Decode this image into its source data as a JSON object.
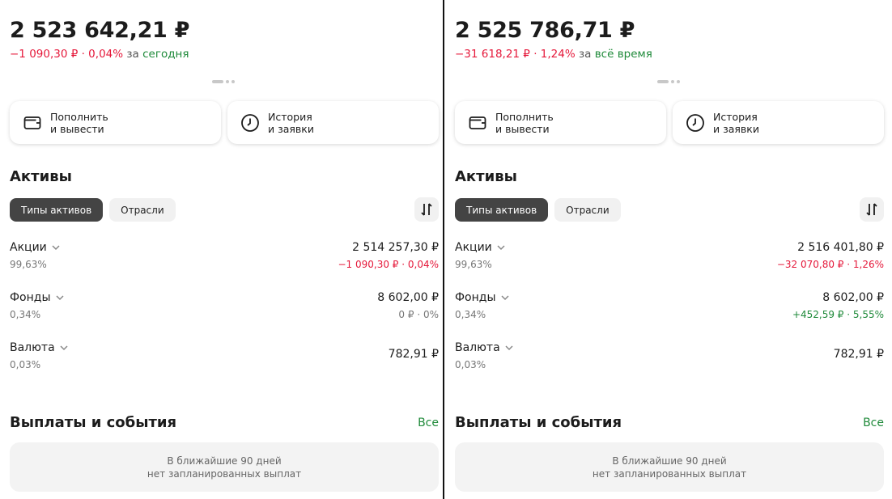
{
  "left": {
    "total": "2 523 642,21 ₽",
    "change": "−1 090,30 ₽ · 0,04%",
    "za": "за",
    "period": "сегодня",
    "actions": [
      {
        "label": "Пополнить\nи вывести",
        "icon": "wallet-icon"
      },
      {
        "label": "История\nи заявки",
        "icon": "clock-icon"
      }
    ],
    "assets_title": "Активы",
    "chips": [
      "Типы активов",
      "Отрасли"
    ],
    "assets": [
      {
        "name": "Акции",
        "share": "99,63%",
        "value": "2 514 257,30 ₽",
        "delta": "−1 090,30 ₽ · 0,04%",
        "delta_kind": "neg"
      },
      {
        "name": "Фонды",
        "share": "0,34%",
        "value": "8 602,00 ₽",
        "delta": "0 ₽ · 0%",
        "delta_kind": "zero"
      },
      {
        "name": "Валюта",
        "share": "0,03%",
        "value": "782,91 ₽",
        "delta": "",
        "delta_kind": "none"
      }
    ],
    "events_title": "Выплаты и события",
    "all_link": "Все",
    "events_empty": "В ближайшие 90 дней\nнет запланированных выплат"
  },
  "right": {
    "total": "2 525 786,71 ₽",
    "change": "−31 618,21 ₽ · 1,24%",
    "za": "за",
    "period": "всё время",
    "actions": [
      {
        "label": "Пополнить\nи вывести",
        "icon": "wallet-icon"
      },
      {
        "label": "История\nи заявки",
        "icon": "clock-icon"
      }
    ],
    "assets_title": "Активы",
    "chips": [
      "Типы активов",
      "Отрасли"
    ],
    "assets": [
      {
        "name": "Акции",
        "share": "99,63%",
        "value": "2 516 401,80 ₽",
        "delta": "−32 070,80 ₽ · 1,26%",
        "delta_kind": "neg"
      },
      {
        "name": "Фонды",
        "share": "0,34%",
        "value": "8 602,00 ₽",
        "delta": "+452,59 ₽ · 5,55%",
        "delta_kind": "pos"
      },
      {
        "name": "Валюта",
        "share": "0,03%",
        "value": "782,91 ₽",
        "delta": "",
        "delta_kind": "none"
      }
    ],
    "events_title": "Выплаты и события",
    "all_link": "Все",
    "events_empty": "В ближайшие 90 дней\nнет запланированных выплат"
  },
  "colors": {
    "negative": "#e5183a",
    "positive": "#1f8a3a",
    "chip_active": "#444444",
    "chip_inactive": "#f1f1f1"
  }
}
